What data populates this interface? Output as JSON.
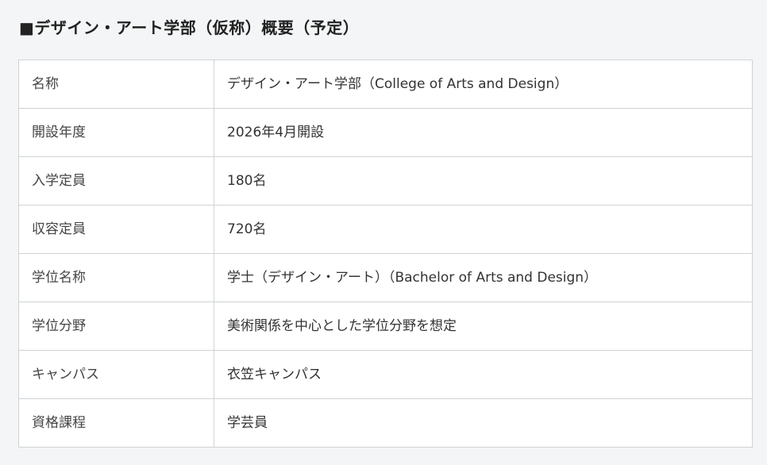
{
  "heading": "■デザイン・アート学部（仮称）概要（予定）",
  "rows": [
    {
      "label": "名称",
      "value": "デザイン・アート学部（College of Arts and Design）"
    },
    {
      "label": "開設年度",
      "value": "2026年4月開設"
    },
    {
      "label": "入学定員",
      "value": "180名"
    },
    {
      "label": "収容定員",
      "value": "720名"
    },
    {
      "label": "学位名称",
      "value": "学士（デザイン・アート）（Bachelor of Arts and Design）"
    },
    {
      "label": "学位分野",
      "value": "美術関係を中心とした学位分野を想定"
    },
    {
      "label": "キャンパス",
      "value": "衣笠キャンパス"
    },
    {
      "label": "資格課程",
      "value": "学芸員"
    }
  ]
}
